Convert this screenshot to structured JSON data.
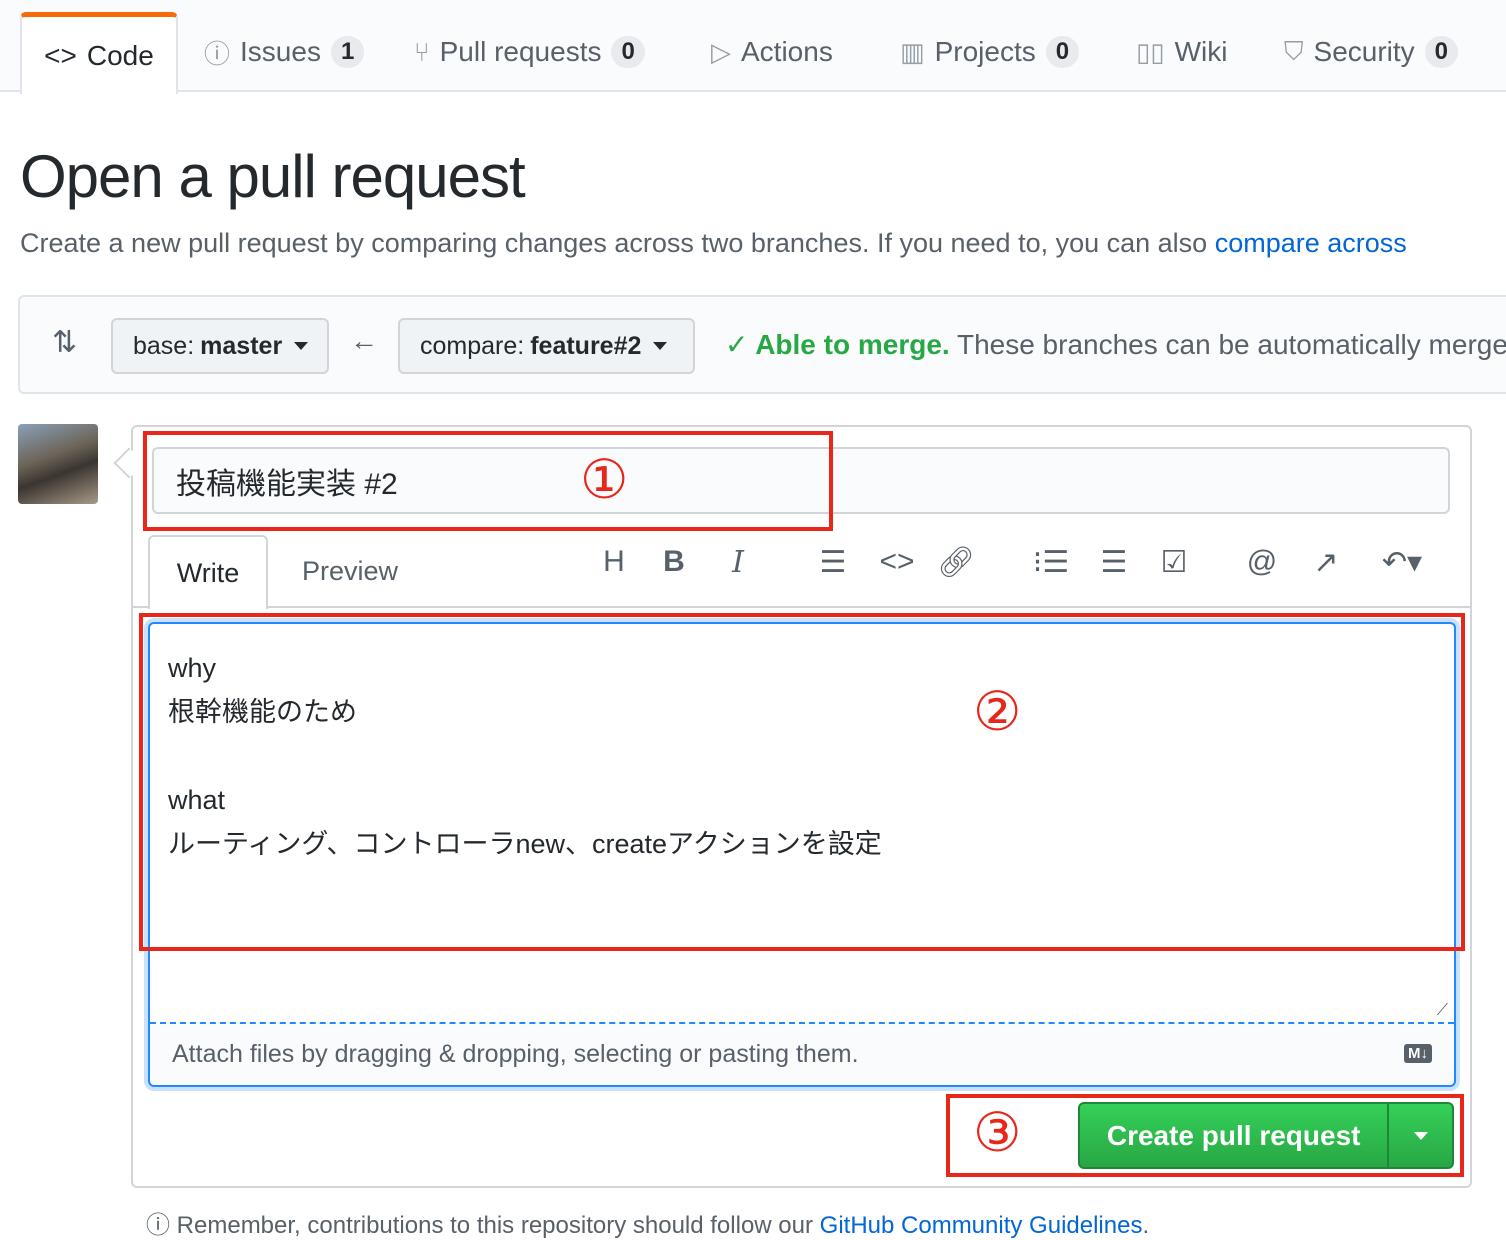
{
  "tabs": [
    {
      "label": "Code",
      "icon": "code-icon"
    },
    {
      "label": "Issues",
      "count": "1",
      "icon": "issue-icon"
    },
    {
      "label": "Pull requests",
      "count": "0",
      "icon": "git-pull-request-icon"
    },
    {
      "label": "Actions",
      "icon": "play-icon"
    },
    {
      "label": "Projects",
      "count": "0",
      "icon": "project-icon"
    },
    {
      "label": "Wiki",
      "icon": "book-icon"
    },
    {
      "label": "Security",
      "count": "0",
      "icon": "shield-icon"
    }
  ],
  "page": {
    "title": "Open a pull request",
    "subtitle": "Create a new pull request by comparing changes across two branches. If you need to, you can also ",
    "subtitle_link": "compare across"
  },
  "compare": {
    "base_prefix": "base: ",
    "base": "master",
    "compare_prefix": "compare: ",
    "compare": "feature#2",
    "merge_status": "Able to merge.",
    "merge_text": " These branches can be automatically merged."
  },
  "form": {
    "title_value": "投稿機能実装 #2",
    "tab_write": "Write",
    "tab_preview": "Preview",
    "body": "why\n根幹機能のため\n\nwhat\nルーティング、コントローラnew、createアクションを設定",
    "attach_hint": "Attach files by dragging & dropping, selecting or pasting them.",
    "markdown_badge": "M↓",
    "submit": "Create pull request"
  },
  "annotations": [
    "①",
    "②",
    "③"
  ],
  "annotation_color": "#e8261a",
  "footer": {
    "text": "Remember, contributions to this repository should follow our ",
    "link": "GitHub Community Guidelines",
    "end": "."
  }
}
